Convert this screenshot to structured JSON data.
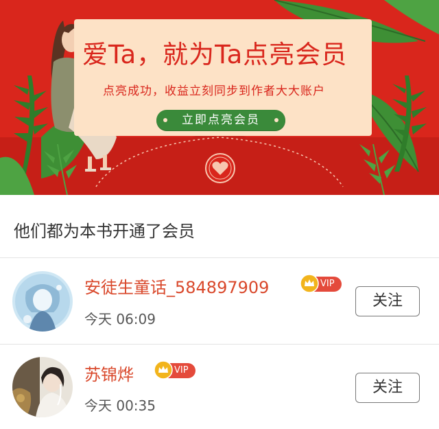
{
  "banner": {
    "title": "爱Ta，就为Ta点亮会员",
    "subtitle": "点亮成功，收益立刻同步到作者大大账户",
    "cta_label": "立即点亮会员",
    "icons": [
      "illustration-girl-reading",
      "leaf-decoration",
      "heart-seal-icon"
    ],
    "colors": {
      "background": "#d9261c",
      "card": "#fde2c6",
      "cta": "#3a8a3a"
    }
  },
  "section": {
    "title": "他们都为本书开通了会员"
  },
  "members": [
    {
      "name": "安徒生童话_584897909",
      "badge": "VIP",
      "time": "今天 06:09",
      "follow_label": "关注"
    },
    {
      "name": "苏锦烨",
      "badge": "VIP",
      "time": "今天 00:35",
      "follow_label": "关注"
    }
  ],
  "colors": {
    "name": "#d9482b",
    "vip_badge": "#e44a3b",
    "crown": "#f2b41c"
  }
}
